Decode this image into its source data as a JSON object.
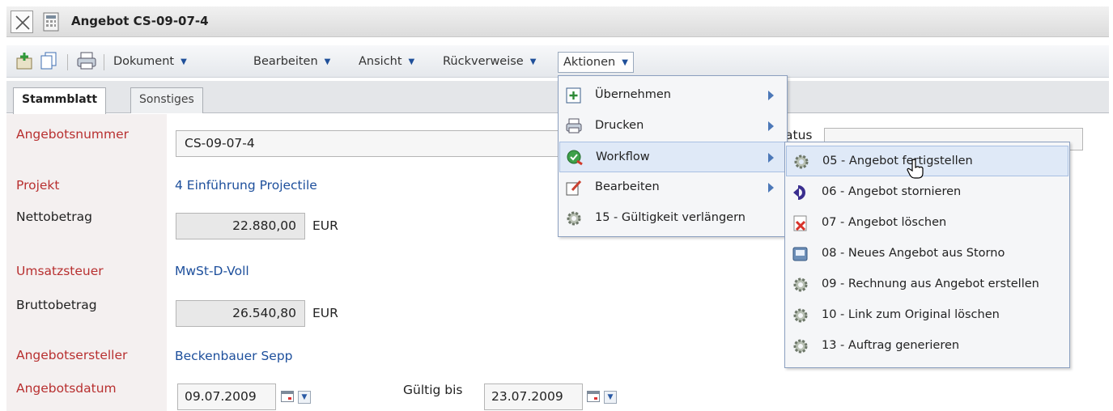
{
  "window": {
    "title": "Angebot CS-09-07-4",
    "close_icon": "close-x-icon",
    "doc_icon": "document-calculator-icon"
  },
  "toolbar": {
    "icons": [
      "add-document-icon",
      "copy-icon",
      "print-icon"
    ],
    "menus": [
      {
        "label": "Dokument"
      },
      {
        "label": "Bearbeiten"
      },
      {
        "label": "Ansicht"
      },
      {
        "label": "Rückverweise"
      },
      {
        "label": "Aktionen",
        "active": true
      }
    ]
  },
  "tabs": [
    {
      "label": "Stammblatt",
      "active": true
    },
    {
      "label": "Sonstiges",
      "active": false
    }
  ],
  "form": {
    "angebotsnummer": {
      "label": "Angebotsnummer",
      "value": "CS-09-07-4"
    },
    "projekt": {
      "label": "Projekt",
      "value": "4 Einführung Projectile"
    },
    "nettobetrag": {
      "label": "Nettobetrag",
      "value": "22.880,00",
      "unit": "EUR"
    },
    "umsatzsteuer": {
      "label": "Umsatzsteuer",
      "value": "MwSt-D-Voll"
    },
    "bruttobetrag": {
      "label": "Bruttobetrag",
      "value": "26.540,80",
      "unit": "EUR"
    },
    "angebotsersteller": {
      "label": "Angebotsersteller",
      "value": "Beckenbauer Sepp"
    },
    "angebotsdatum": {
      "label": "Angebotsdatum",
      "value": "09.07.2009"
    },
    "gueltig_bis": {
      "label": "Gültig bis",
      "value": "23.07.2009"
    },
    "status": {
      "label_fragment": "atus"
    }
  },
  "aktionen_menu": [
    {
      "label": "Übernehmen",
      "icon": "add-document-icon",
      "submenu": true
    },
    {
      "label": "Drucken",
      "icon": "printer-icon",
      "submenu": true
    },
    {
      "label": "Workflow",
      "icon": "workflow-check-icon",
      "submenu": true,
      "highlighted": true
    },
    {
      "label": "Bearbeiten",
      "icon": "edit-icon",
      "submenu": true
    },
    {
      "label": "15 - Gültigkeit verlängern",
      "icon": "gear-icon",
      "submenu": false
    }
  ],
  "workflow_menu": [
    {
      "label": "05 - Angebot fertigstellen",
      "icon": "gear-icon",
      "highlighted": true
    },
    {
      "label": "06 - Angebot stornieren",
      "icon": "undo-arrow-icon"
    },
    {
      "label": "07 - Angebot löschen",
      "icon": "delete-document-icon"
    },
    {
      "label": "08 - Neues Angebot aus Storno",
      "icon": "new-document-icon"
    },
    {
      "label": "09 - Rechnung aus Angebot erstellen",
      "icon": "gear-icon"
    },
    {
      "label": "10 - Link zum Original löschen",
      "icon": "gear-icon"
    },
    {
      "label": "13 - Auftrag generieren",
      "icon": "gear-icon"
    }
  ],
  "colors": {
    "required_label": "#b83030",
    "link": "#1d4f9c",
    "menu_highlight": "#dfe9f7"
  }
}
